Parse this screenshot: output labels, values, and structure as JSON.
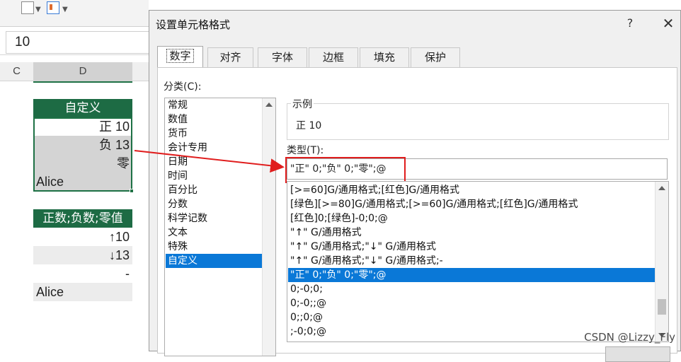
{
  "excel": {
    "formula_value": "10",
    "columns": [
      "C",
      "D"
    ],
    "table1": {
      "header": "自定义",
      "rows": [
        "正 10",
        "负 13",
        "零",
        "Alice"
      ]
    },
    "table2": {
      "header": "正数;负数;零值",
      "rows": [
        "↑10",
        "↓13",
        "-",
        "Alice"
      ]
    }
  },
  "dialog": {
    "title": "设置单元格格式",
    "help": "?",
    "close": "✕",
    "tabs": [
      "数字",
      "对齐",
      "字体",
      "边框",
      "填充",
      "保护"
    ],
    "category_label": "分类(C):",
    "categories": [
      "常规",
      "数值",
      "货币",
      "会计专用",
      "日期",
      "时间",
      "百分比",
      "分数",
      "科学记数",
      "文本",
      "特殊",
      "自定义"
    ],
    "selected_category": "自定义",
    "sample_caption": "示例",
    "sample_value": "正 10",
    "type_label": "类型(T):",
    "type_value": "\"正\" 0;\"负\" 0;\"零\";@",
    "formats": [
      "[>=60]G/通用格式;[红色]G/通用格式",
      "[绿色][>=80]G/通用格式;[>=60]G/通用格式;[红色]G/通用格式",
      "[红色]0;[绿色]-0;0;@",
      "\"↑\" G/通用格式",
      "\"↑\" G/通用格式;\"↓\" G/通用格式",
      "\"↑\" G/通用格式;\"↓\" G/通用格式;-",
      "\"正\" 0;\"负\" 0;\"零\";@",
      "0;-0;0;",
      "0;-0;;@",
      "0;;0;@",
      ";-0;0;@"
    ],
    "selected_format_index": 6
  },
  "watermark": "CSDN @Lizzy_Fly",
  "colors": {
    "excel_green": "#1d6b44",
    "selection_blue": "#0a78d7",
    "annotation_red": "#e01d1d"
  }
}
